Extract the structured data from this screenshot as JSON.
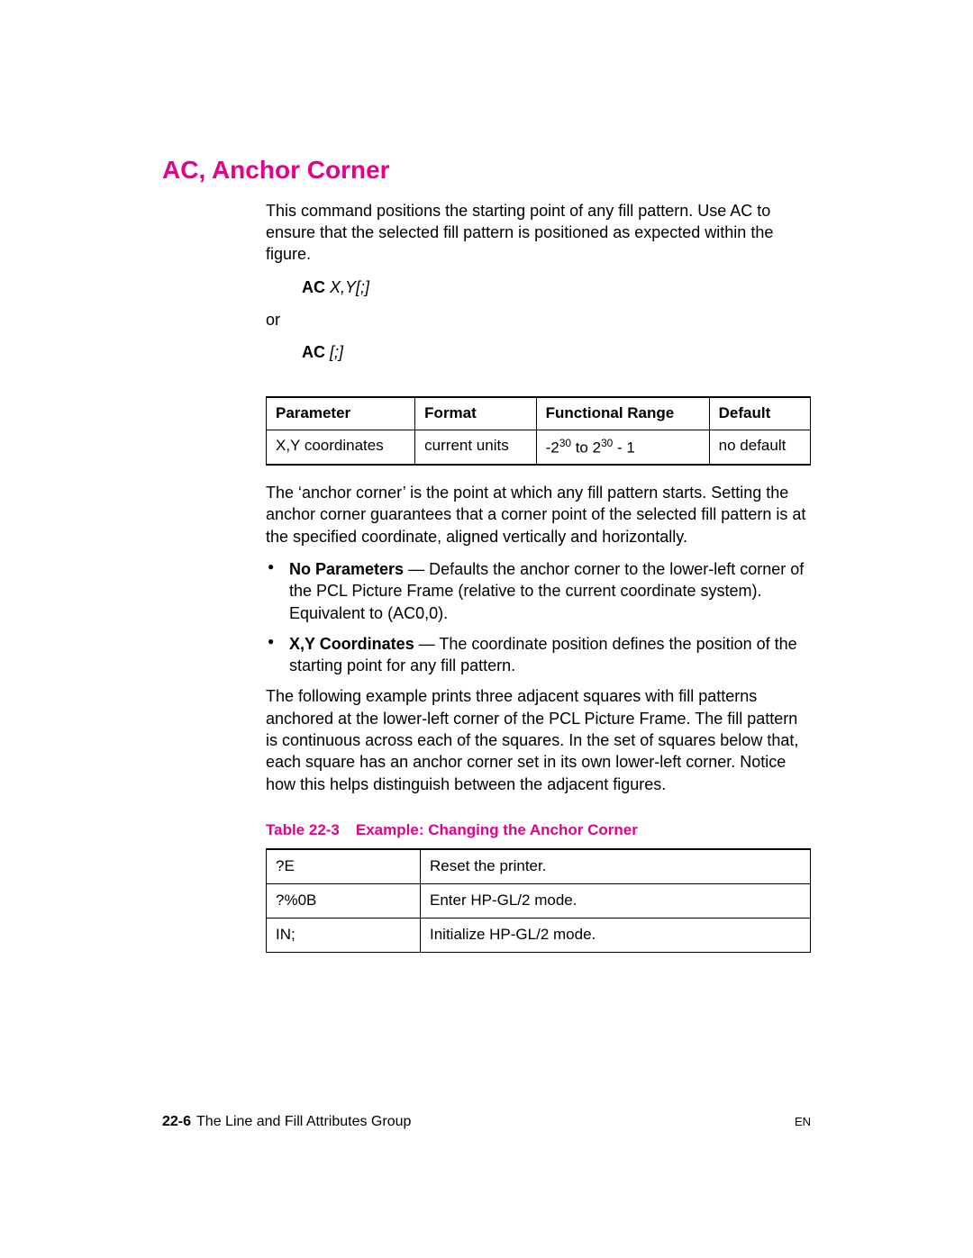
{
  "heading": "AC, Anchor Corner",
  "intro": "This command positions the starting point of any fill pattern. Use AC to ensure that the selected fill pattern is positioned as expected within the figure.",
  "syntax1": {
    "cmd": "AC",
    "args": "X,Y[;]"
  },
  "or": "or",
  "syntax2": {
    "cmd": "AC",
    "args": "[;]"
  },
  "param_table": {
    "headers": {
      "parameter": "Parameter",
      "format": "Format",
      "range": "Functional Range",
      "default": "Default"
    },
    "row": {
      "parameter": "X,Y coordinates",
      "format": "current units",
      "range": {
        "prefix": "-2",
        "sup1": "30",
        "mid": " to 2",
        "sup2": "30",
        "suffix": " - 1"
      },
      "default": "no default"
    }
  },
  "para_anchor": "The ‘anchor corner’ is the point at which any fill pattern starts. Setting the anchor corner guarantees that a corner point of the selected fill pattern is at the specified coordinate, aligned vertically and horizontally.",
  "bullets": {
    "b1": {
      "label": "No Parameters",
      "text": " — Defaults the anchor corner to the lower-left corner of the PCL Picture Frame (relative to the current coordinate system). Equivalent to (AC0,0)."
    },
    "b2": {
      "label": "X,Y Coordinates",
      "text": " — The coordinate position defines the position of the starting point for any fill pattern."
    }
  },
  "para_following": "The following example prints three adjacent squares with fill patterns anchored at the lower-left corner of the PCL Picture Frame. The fill pattern is continuous across each of the squares. In the set of squares below that, each square has an anchor corner set in its own lower-left corner. Notice how this helps distinguish between the adjacent figures.",
  "table_caption": {
    "num": "Table 22-3",
    "title": "Example: Changing the Anchor Corner"
  },
  "example_table": {
    "rows": [
      {
        "code": "?E",
        "desc": "Reset the printer."
      },
      {
        "code": "?%0B",
        "desc": "Enter HP-GL/2 mode."
      },
      {
        "code": "IN;",
        "desc": "Initialize HP-GL/2 mode."
      }
    ]
  },
  "footer": {
    "page_num": "22-6",
    "section": "The Line and Fill Attributes Group",
    "lang": "EN"
  }
}
